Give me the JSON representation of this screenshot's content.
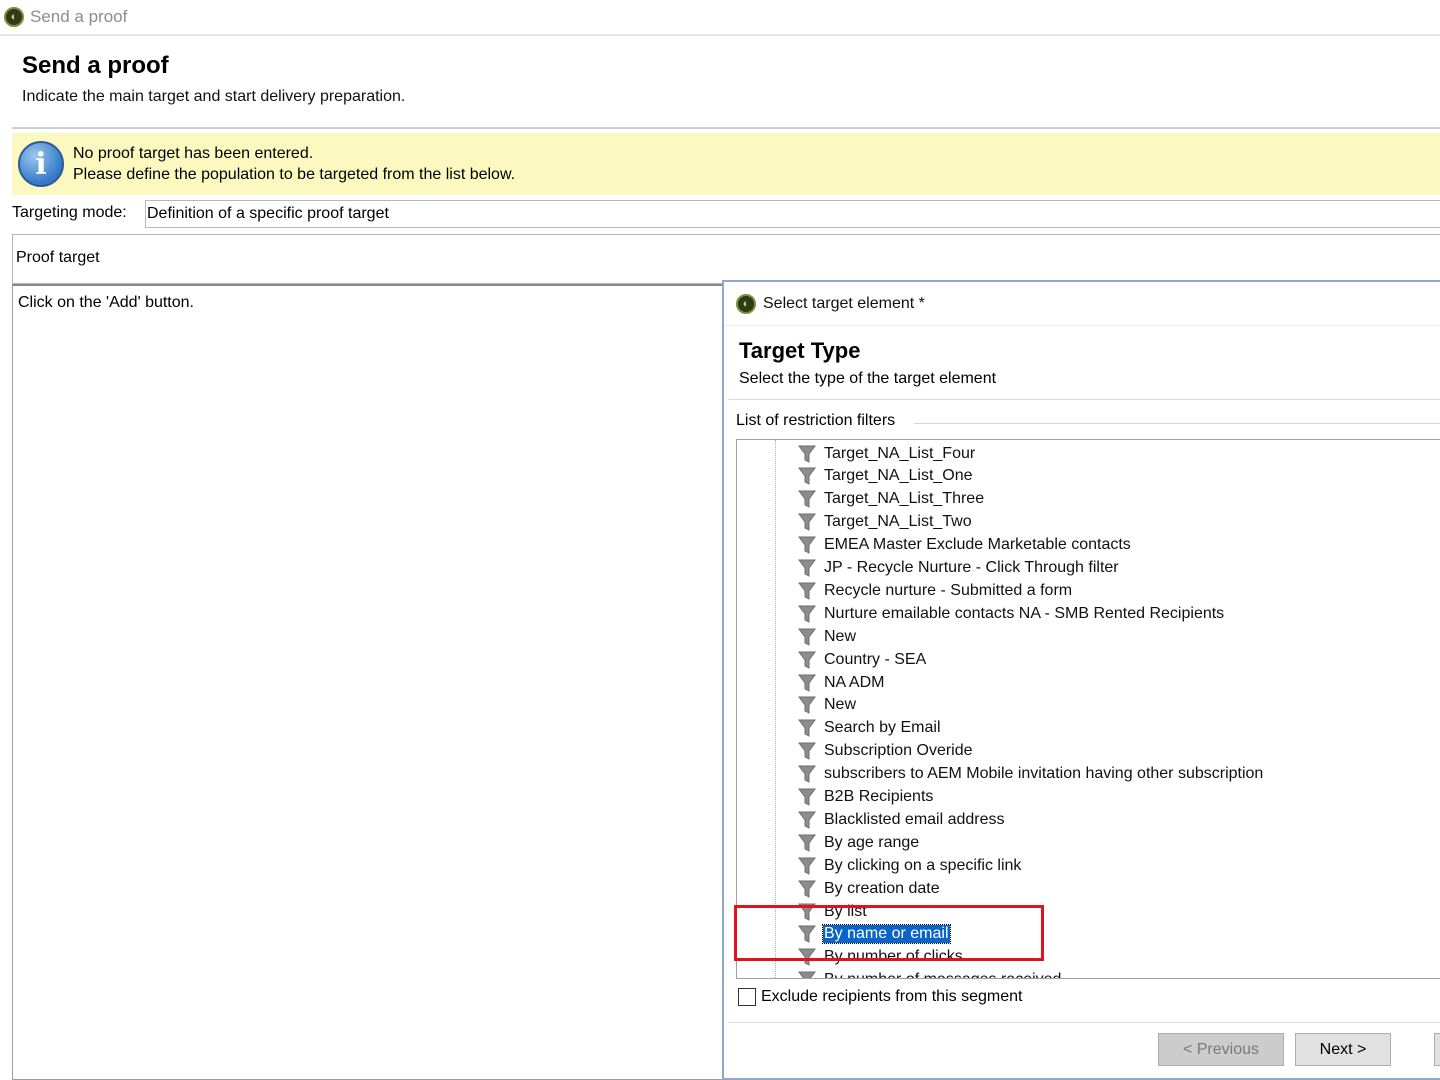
{
  "window": {
    "title": "Send a proof"
  },
  "header": {
    "title": "Send a proof",
    "subtitle": "Indicate the main target and start delivery preparation."
  },
  "info": {
    "line1": "No proof target has been entered.",
    "line2": "Please define the population to be targeted from the list below."
  },
  "targeting": {
    "label": "Targeting mode:",
    "value": "Definition of a specific proof target"
  },
  "proof_target_tab": "Proof target",
  "left_panel_text": "Click on the 'Add' button.",
  "dialog": {
    "title": "Select target element *",
    "heading": "Target Type",
    "subheading": "Select the type of the target element",
    "group_label": "List of restriction filters",
    "filters": [
      "Target_NA_List_Four",
      "Target_NA_List_One",
      "Target_NA_List_Three",
      "Target_NA_List_Two",
      "EMEA Master Exclude Marketable contacts",
      "JP - Recycle Nurture - Click Through filter",
      "Recycle nurture - Submitted a form",
      "Nurture emailable contacts NA - SMB Rented Recipients",
      "New",
      "Country - SEA",
      "NA ADM",
      "New",
      "Search by Email",
      "Subscription Overide",
      "subscribers to AEM Mobile invitation having other subscription",
      "B2B Recipients",
      "Blacklisted email address",
      "By age range",
      "By clicking on a specific link",
      "By creation date",
      "By list",
      "By name or email",
      "By number of clicks",
      "By number of messages received"
    ],
    "selected_filter": "By name or email",
    "exclude_label": "Exclude recipients from this segment",
    "exclude_checked": false,
    "buttons": {
      "previous": "< Previous",
      "next": "Next >"
    }
  },
  "colors": {
    "selection": "#0b64c8",
    "highlight_box": "#e0141e",
    "info_background": "#fbf9c0"
  }
}
